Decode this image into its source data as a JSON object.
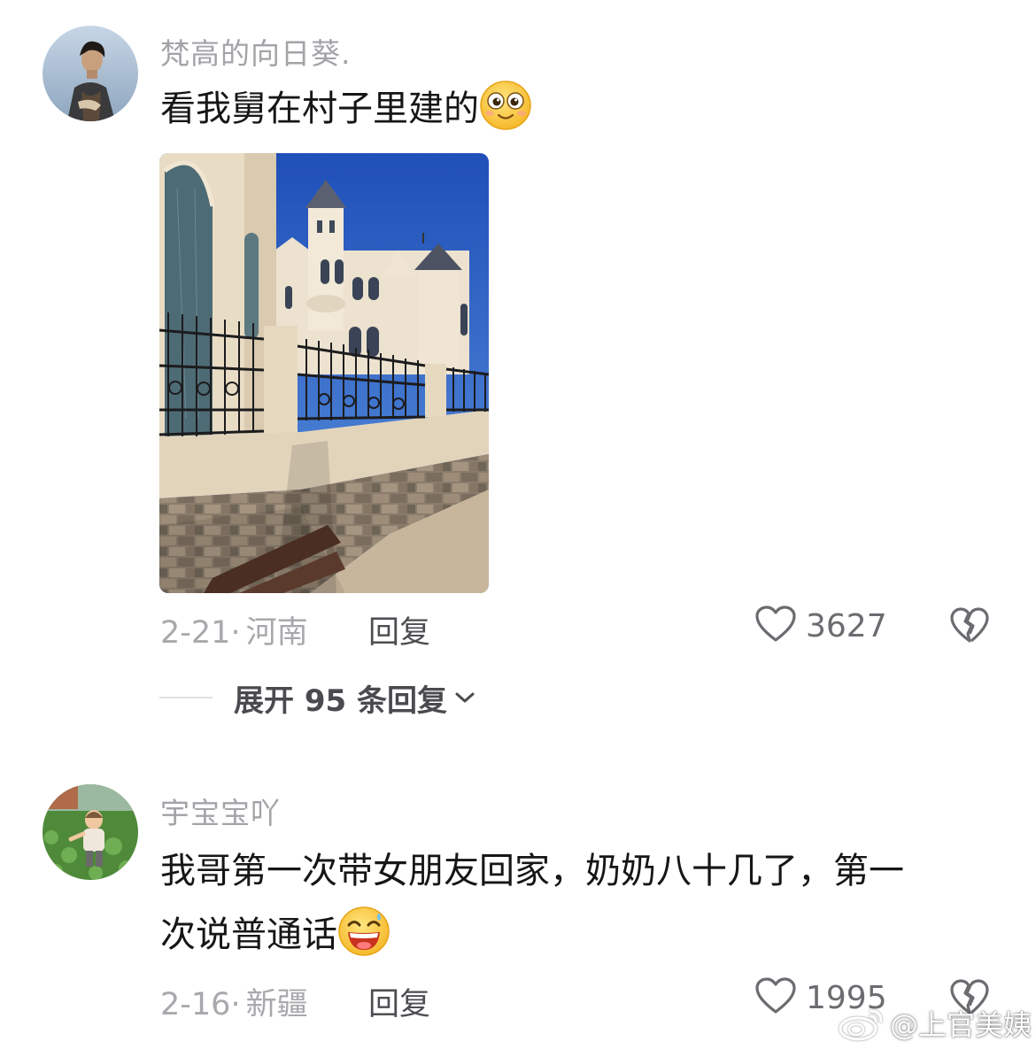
{
  "comments": [
    {
      "username": "梵高的向日葵.",
      "text": "看我舅在村子里建的",
      "emoji": "smiley-wide-eyes",
      "has_photo": true,
      "date": "2-21",
      "separator": "·",
      "location": "河南",
      "reply_label": "回复",
      "likes": "3627",
      "expand_label": "展开 95 条回复"
    },
    {
      "username": "宇宝宝吖",
      "text_line1": "我哥第一次带女朋友回家，奶奶八十几了，第一",
      "text_line2": "次说普通话",
      "emoji": "grinning-sweat",
      "date": "2-16",
      "separator": "·",
      "location": "新疆",
      "reply_label": "回复",
      "likes": "1995"
    }
  ],
  "watermark": {
    "text": "@上官美姨",
    "icon": "weibo-icon"
  },
  "colors": {
    "username": "#a3a3a8",
    "text": "#161616",
    "meta": "#a8a8ad",
    "sky": "#2f64c9"
  }
}
